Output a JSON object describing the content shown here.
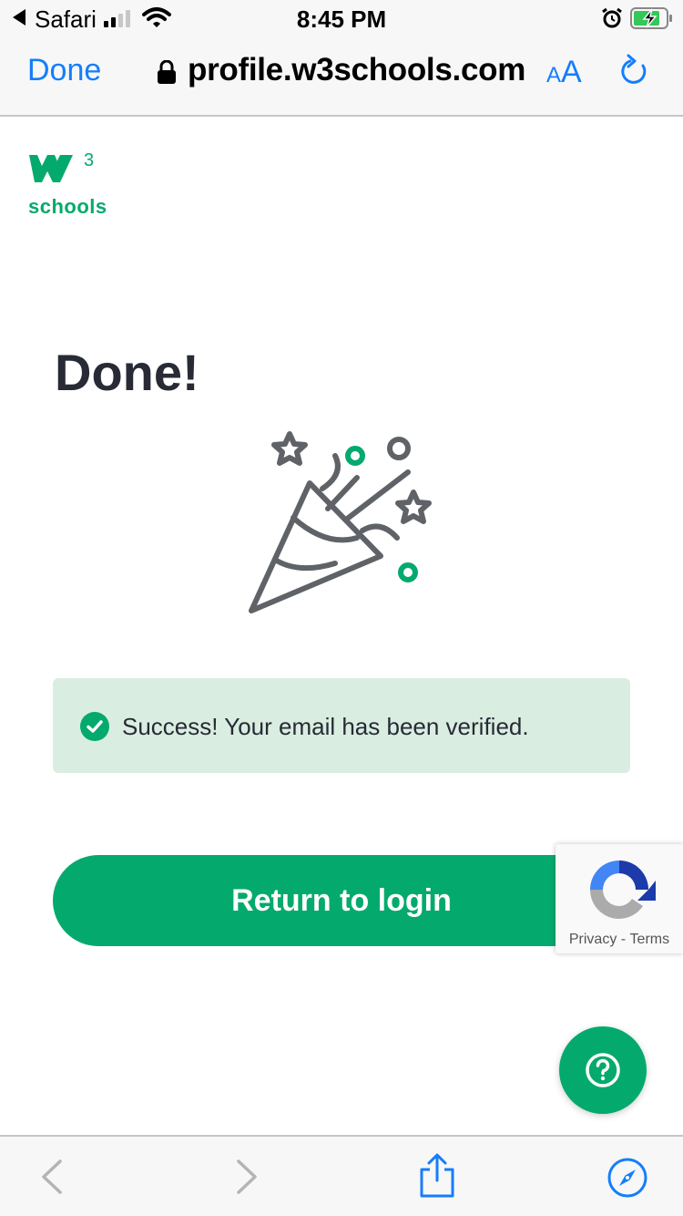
{
  "status_bar": {
    "app": "Safari",
    "time": "8:45 PM"
  },
  "browser": {
    "done_label": "Done",
    "domain": "profile.w3schools.com",
    "text_size_small": "A",
    "text_size_big": "A"
  },
  "logo": {
    "text": "schools"
  },
  "page": {
    "title": "Done!",
    "alert_text": "Success! Your email has been verified.",
    "return_button": "Return to login"
  },
  "recaptcha": {
    "privacy": "Privacy",
    "separator": " - ",
    "terms": "Terms"
  },
  "colors": {
    "brand_green": "#04aa6d",
    "alert_bg": "#d9eee1",
    "ios_blue": "#147efb",
    "icon_gray": "#5f6368"
  },
  "icons": {
    "help": "question-icon",
    "illustration": "party-popper-icon"
  }
}
